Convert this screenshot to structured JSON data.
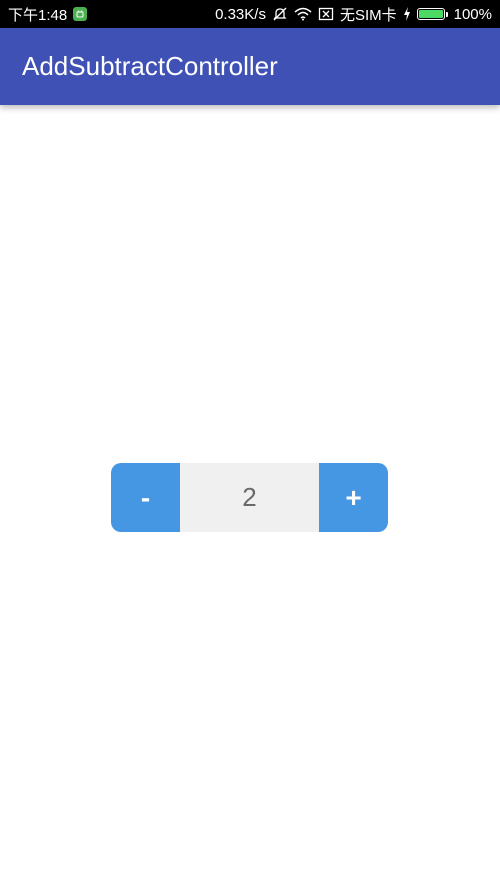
{
  "status_bar": {
    "time": "下午1:48",
    "speed": "0.33K/s",
    "sim": "无SIM卡",
    "battery_text": "100%",
    "battery_level": 1.0,
    "icons": [
      "app-notification-icon",
      "mute-icon",
      "wifi-icon",
      "no-sim-icon",
      "charging-icon",
      "battery-icon"
    ]
  },
  "app_bar": {
    "title": "AddSubtractController",
    "color": "#3f51b5"
  },
  "controller": {
    "minus_label": "-",
    "value": "2",
    "plus_label": "+",
    "button_color": "#4597e4",
    "value_bg": "#f0f0f0"
  }
}
